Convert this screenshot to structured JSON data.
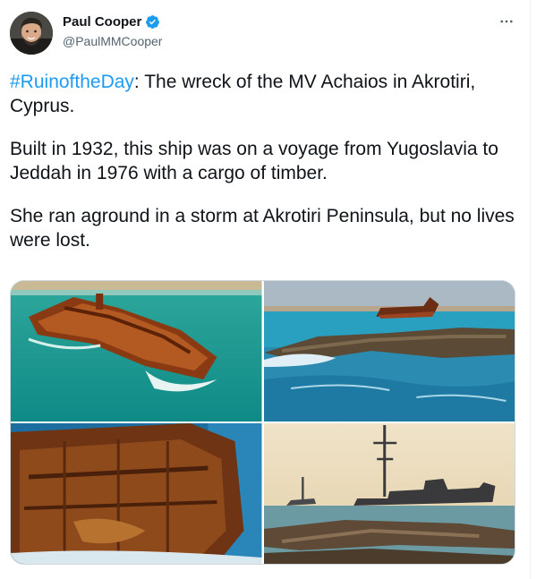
{
  "author": {
    "display_name": "Paul Cooper",
    "handle": "@PaulMMCooper",
    "verified": true,
    "avatar_icon": "person-portrait"
  },
  "tweet": {
    "hashtag": "#RuinoftheDay",
    "line1_rest": ": The wreck of the MV Achaios in Akrotiri, Cyprus.",
    "para2": "Built in 1932, this ship was on a voyage from Yugoslavia to Jeddah in 1976 with a cargo of timber.",
    "para3": "She ran aground in a storm at Akrotiri Peninsula, but no lives were lost."
  },
  "media": {
    "photos": [
      {
        "alt": "rusted shipwreck in turquoise water (aerial)"
      },
      {
        "alt": "shipwreck behind rocky shore with waves"
      },
      {
        "alt": "close-up of rusted hull"
      },
      {
        "alt": "silhouette of wreck at sunset with flat rocks"
      }
    ]
  },
  "colors": {
    "accent": "#1d9bf0",
    "text": "#0f1419",
    "secondary": "#536471"
  }
}
